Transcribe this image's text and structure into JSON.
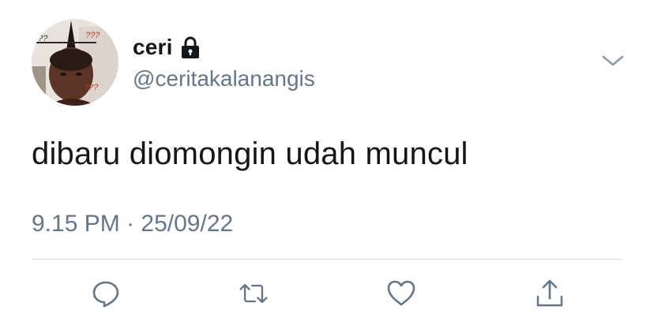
{
  "author": {
    "display_name": "ceri",
    "handle": "@ceritakalanangis",
    "locked": true,
    "lock_icon": "lock-icon",
    "avatar_doodles": [
      "???",
      "???",
      "???"
    ]
  },
  "tweet": {
    "text": "dibaru diomongin udah muncul",
    "time": "9.15 PM",
    "separator": "·",
    "date": "25/09/22"
  },
  "actions": [
    {
      "icon": "reply-icon"
    },
    {
      "icon": "retweet-icon"
    },
    {
      "icon": "like-icon"
    },
    {
      "icon": "share-icon"
    }
  ],
  "colors": {
    "text_primary": "#14171a",
    "text_secondary": "#657786",
    "icon": "#657786",
    "divider": "#d7dde2"
  }
}
